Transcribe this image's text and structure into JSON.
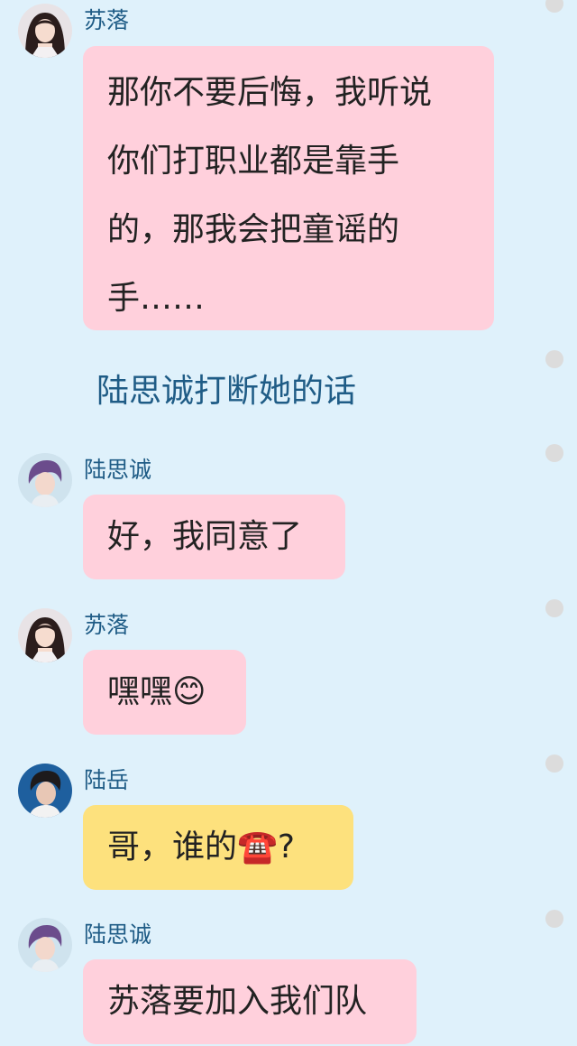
{
  "messages": [
    {
      "sender": "苏落",
      "avatar": "female-avatar",
      "lines": [
        "那你不要后悔，我听说",
        "你们打职业都是靠手",
        "的，那我会把童谣的",
        "手……"
      ]
    },
    {
      "sender": "陆思诚",
      "avatar": "male-avatar-purple",
      "lines": [
        "好，我同意了"
      ]
    },
    {
      "sender": "苏落",
      "avatar": "female-avatar",
      "lines": [
        "嘿嘿😊"
      ]
    },
    {
      "sender": "陆岳",
      "avatar": "male-avatar-dark",
      "lines": [
        "哥，谁的☎️?"
      ]
    },
    {
      "sender": "陆思诚",
      "avatar": "male-avatar-purple",
      "lines": [
        "苏落要加入我们队"
      ]
    }
  ],
  "narration": "陆思诚打断她的话",
  "colors": {
    "background": "#dff1fb",
    "bubble_pink": "#ffd0dc",
    "bubble_yellow": "#fde17d",
    "name_text": "#1f5c86"
  }
}
